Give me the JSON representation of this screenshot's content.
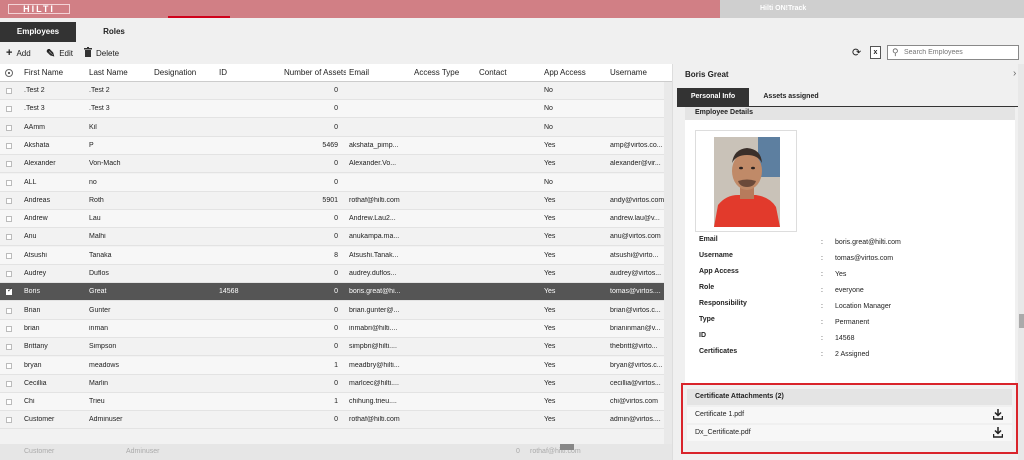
{
  "header": {
    "logo_text": "HILTI",
    "app_name": "Hilti ON!Track",
    "colors": {
      "brand_bar": "#d17f85",
      "accent": "#d0021b"
    }
  },
  "tabs": [
    {
      "label": "Employees",
      "active": true
    },
    {
      "label": "Roles",
      "active": false
    }
  ],
  "toolbar": {
    "add_label": "Add",
    "edit_label": "Edit",
    "delete_label": "Delete",
    "refresh_icon": "refresh-icon",
    "excel_icon": "excel-export-icon",
    "search_placeholder": "Search Employees"
  },
  "table": {
    "columns": [
      "First Name",
      "Last Name",
      "Designation",
      "ID",
      "Number of Assets",
      "Email",
      "Access Type",
      "Contact",
      "App Access",
      "Username"
    ],
    "rows": [
      {
        "first": ".Test 2",
        "last": ".Test 2",
        "designation": "",
        "id": "",
        "assets": "0",
        "email": "",
        "access_type": "",
        "contact": "",
        "app_access": "No",
        "username": ""
      },
      {
        "first": ".Test 3",
        "last": ".Test 3",
        "designation": "",
        "id": "",
        "assets": "0",
        "email": "",
        "access_type": "",
        "contact": "",
        "app_access": "No",
        "username": ""
      },
      {
        "first": "AAmm",
        "last": "Kil",
        "designation": "",
        "id": "",
        "assets": "0",
        "email": "",
        "access_type": "",
        "contact": "",
        "app_access": "No",
        "username": ""
      },
      {
        "first": "Akshata",
        "last": "P",
        "designation": "",
        "id": "",
        "assets": "5469",
        "email": "akshata_pimp...",
        "access_type": "",
        "contact": "",
        "app_access": "Yes",
        "username": "amp@virtos.co..."
      },
      {
        "first": "Alexander",
        "last": "Von-Mach",
        "designation": "",
        "id": "",
        "assets": "0",
        "email": "Alexander.Vo...",
        "access_type": "",
        "contact": "",
        "app_access": "Yes",
        "username": "alexander@vir..."
      },
      {
        "first": "ALL",
        "last": "no",
        "designation": "",
        "id": "",
        "assets": "0",
        "email": "",
        "access_type": "",
        "contact": "",
        "app_access": "No",
        "username": ""
      },
      {
        "first": "Andreas",
        "last": "Roth",
        "designation": "",
        "id": "",
        "assets": "5901",
        "email": "rothaf@hilti.com",
        "access_type": "",
        "contact": "",
        "app_access": "Yes",
        "username": "andy@virtos.com"
      },
      {
        "first": "Andrew",
        "last": "Lau",
        "designation": "",
        "id": "",
        "assets": "0",
        "email": "Andrew.Lau2...",
        "access_type": "",
        "contact": "",
        "app_access": "Yes",
        "username": "andrew.lau@v..."
      },
      {
        "first": "Anu",
        "last": "Malhi",
        "designation": "",
        "id": "",
        "assets": "0",
        "email": "anukampa.ma...",
        "access_type": "",
        "contact": "",
        "app_access": "Yes",
        "username": "anu@virtos.com"
      },
      {
        "first": "Atsushi",
        "last": "Tanaka",
        "designation": "",
        "id": "",
        "assets": "8",
        "email": "Atsushi.Tanak...",
        "access_type": "",
        "contact": "",
        "app_access": "Yes",
        "username": "atsushi@virto..."
      },
      {
        "first": "Audrey",
        "last": "Duflos",
        "designation": "",
        "id": "",
        "assets": "0",
        "email": "audrey.duflos...",
        "access_type": "",
        "contact": "",
        "app_access": "Yes",
        "username": "audrey@virtos..."
      },
      {
        "first": "Boris",
        "last": "Great",
        "designation": "",
        "id": "14568",
        "assets": "0",
        "email": "boris.great@hi...",
        "access_type": "",
        "contact": "",
        "app_access": "Yes",
        "username": "tomas@virtos...."
      },
      {
        "first": "Brian",
        "last": "Gunter",
        "designation": "",
        "id": "",
        "assets": "0",
        "email": "brian.gunter@...",
        "access_type": "",
        "contact": "",
        "app_access": "Yes",
        "username": "brian@virtos.c..."
      },
      {
        "first": "brian",
        "last": "inman",
        "designation": "",
        "id": "",
        "assets": "0",
        "email": "inmabri@hilti....",
        "access_type": "",
        "contact": "",
        "app_access": "Yes",
        "username": "brianinman@v..."
      },
      {
        "first": "Brittany",
        "last": "Simpson",
        "designation": "",
        "id": "",
        "assets": "0",
        "email": "simpbri@hilti....",
        "access_type": "",
        "contact": "",
        "app_access": "Yes",
        "username": "thebritt@virto..."
      },
      {
        "first": "bryan",
        "last": "meadows",
        "designation": "",
        "id": "",
        "assets": "1",
        "email": "meadbry@hilti...",
        "access_type": "",
        "contact": "",
        "app_access": "Yes",
        "username": "bryan@virtos.c..."
      },
      {
        "first": "Cecillia",
        "last": "Marlin",
        "designation": "",
        "id": "",
        "assets": "0",
        "email": "marlcec@hilti....",
        "access_type": "",
        "contact": "",
        "app_access": "Yes",
        "username": "cecillia@virtos..."
      },
      {
        "first": "Chi",
        "last": "Trieu",
        "designation": "",
        "id": "",
        "assets": "1",
        "email": "chihung.trieu....",
        "access_type": "",
        "contact": "",
        "app_access": "Yes",
        "username": "chi@virtos.com"
      },
      {
        "first": "Customer",
        "last": "Adminuser",
        "designation": "",
        "id": "",
        "assets": "0",
        "email": "rothaf@hilti.com",
        "access_type": "",
        "contact": "",
        "app_access": "Yes",
        "username": "admin@virtos...."
      }
    ],
    "selected_index": 11
  },
  "footer": {
    "first": "Customer",
    "last": "Adminuser",
    "assets": "0",
    "email": "rothaf@hilti.com",
    "app_access": "Yes",
    "username": "admin@virtos.com"
  },
  "panel": {
    "title": "Boris Great",
    "tabs": [
      {
        "label": "Personal Info",
        "active": true
      },
      {
        "label": "Assets assigned",
        "active": false
      }
    ],
    "section_title": "Employee Details",
    "details": [
      {
        "label": "Email",
        "value": "boris.great@hilti.com"
      },
      {
        "label": "Username",
        "value": "tomas@virtos.com"
      },
      {
        "label": "App Access",
        "value": "Yes"
      },
      {
        "label": "Role",
        "value": "everyone"
      },
      {
        "label": "Responsibility",
        "value": "Location Manager"
      },
      {
        "label": "Type",
        "value": "Permanent"
      },
      {
        "label": "ID",
        "value": "14568"
      },
      {
        "label": "Certificates",
        "value": "2 Assigned"
      }
    ],
    "cert_title": "Certificate Attachments (2)",
    "certificates": [
      {
        "name": "Certificate 1.pdf"
      },
      {
        "name": "Dx_Certificate.pdf"
      }
    ]
  }
}
